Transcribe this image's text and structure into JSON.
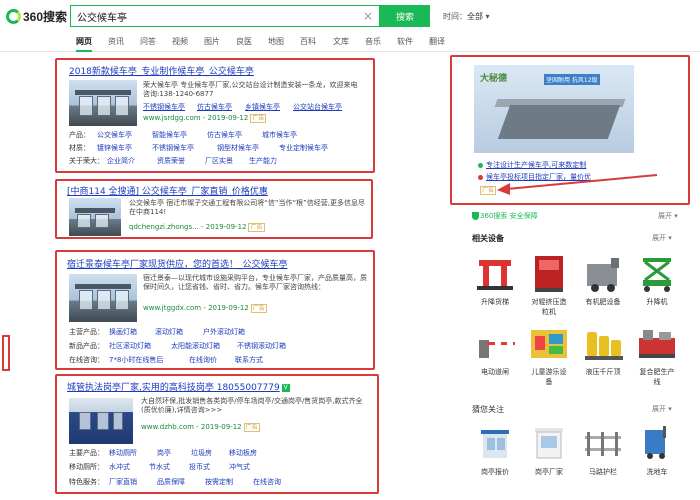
{
  "header": {
    "logo_text": "360搜索",
    "query": "公交候车亭",
    "search_button": "搜索",
    "time_label": "时间：",
    "time_value": "全部"
  },
  "nav": [
    "网页",
    "资讯",
    "问答",
    "视频",
    "图片",
    "良医",
    "地图",
    "百科",
    "文库",
    "音乐",
    "软件",
    "翻译"
  ],
  "results": [
    {
      "title": "2018新款候车亭_专业制作候车亭_公交候车亭",
      "desc": "荣大候车亭 专业候车亭厂家,公交站台设计制造安装一条龙，欢迎来电咨询:138-1240-6877",
      "sublinks": [
        "不锈钢候车亭",
        "仿古候车亭",
        "乡镇候车亭",
        "公交站台候车亭"
      ],
      "url": "www.jsrdgg.com",
      "date": "2019-09-12",
      "ad": "广告",
      "row1_label": "产品：",
      "row1": [
        "公交候车亭",
        "智能候车亭",
        "仿古候车亭",
        "城市候车亭"
      ],
      "row2_label": "材质：",
      "row2": [
        "镀锌候车亭",
        "不锈钢候车亭",
        "钢型材候车亭",
        "专业定制候车亭"
      ],
      "row3_label": "关于荣大：",
      "row3": [
        "企业简介",
        "资质荣誉",
        "厂区实景",
        "生产能力"
      ]
    },
    {
      "title": "[中商114 全搜通] 公交候车亭_厂家直销_价格优惠",
      "desc": "公交候车亭 宿迁市璨子交通工程有限公司将“信”当作“根”信经营,更多信息尽在中商114!",
      "url": "qdchengzi.zhongs...",
      "date": "2019-09-12",
      "ad": "广告"
    },
    {
      "title": "宿迁景泰候车亭厂家现货供应，您的首选！_公交候车亭",
      "desc": "宿迁景泰—以现代城市设施采购平台，专业候车亭厂家，产品质量高，质保时间久，让您省钱、省时、省力。候车亭厂家咨询热线：",
      "url": "www.jtggdx.com",
      "date": "2019-09-12",
      "ad": "广告",
      "row1_label": "主营产品：",
      "row1": [
        "换画灯箱",
        "滚动灯箱",
        "户外滚动灯箱"
      ],
      "row2_label": "新品产品：",
      "row2": [
        "社区滚动灯箱",
        "太阳能滚动灯箱",
        "不锈钢滚动灯箱"
      ],
      "row3_label": "在线咨询：",
      "row3": [
        "7*8小时在线售后",
        "在线询价",
        "联系方式"
      ]
    },
    {
      "title": "城管执法岗亭厂家,实用的高科技岗亭 18055007779",
      "desc": "大自然环保,批发销售各类岗亭/停车场岗亭/交通岗亭/售货岗亭,款式齐全(质优价廉),详情咨询>>>",
      "url": "www.dzhb.com",
      "date": "2019-09-12",
      "ad": "广告",
      "row1_label": "主要产品：",
      "row1": [
        "移动厕所",
        "岗亭",
        "垃圾房",
        "移动板房"
      ],
      "row2_label": "移动厕所：",
      "row2": [
        "水冲式",
        "节水式",
        "投币式",
        "冲气式"
      ],
      "row3_label": "特色服务：",
      "row3": [
        "厂家直销",
        "品质保障",
        "按需定制",
        "在线咨询"
      ]
    }
  ],
  "right_ad": {
    "brand": "大秘德",
    "slogan": "坚固耐用   抗风12级",
    "line1": "专注设计生产候车亭,可来数定制",
    "line2": "候车亭投标项目指定厂家，量价优",
    "ad": "广告",
    "colors": {
      "dot1": "#19b955",
      "dot2": "#d93a3a"
    }
  },
  "safe_guard": {
    "label": "360搜索",
    "text": "安全保障",
    "expand": "展开"
  },
  "related": {
    "title": "相关设备",
    "expand": "展开",
    "items": [
      "升降货梯",
      "对辊挤压造粒机",
      "有机肥设备",
      "升降机",
      "电动道闸",
      "儿童游乐设备",
      "液压千斤顶",
      "复合肥生产线"
    ]
  },
  "guess": {
    "title": "猜您关注",
    "expand": "展开",
    "items": [
      "岗亭报价",
      "岗亭厂家",
      "马路护栏",
      "洗地车"
    ]
  }
}
